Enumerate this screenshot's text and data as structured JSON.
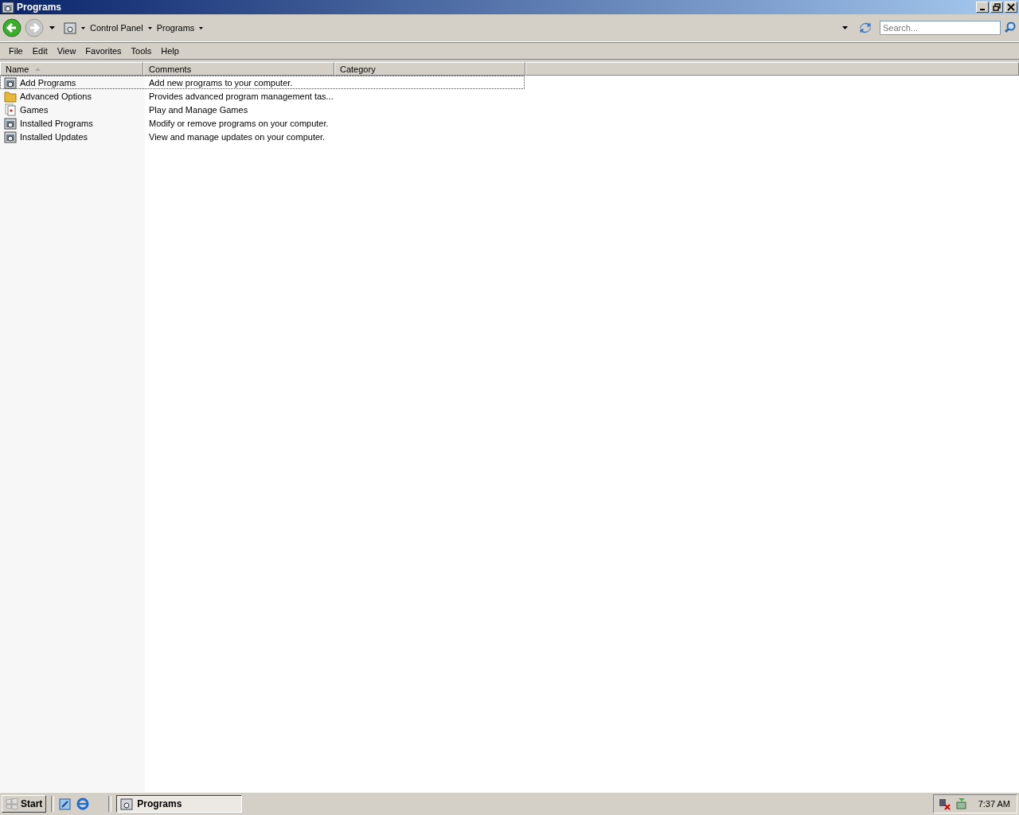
{
  "window": {
    "title": "Programs"
  },
  "address_bar": {
    "crumbs": [
      "Control Panel",
      "Programs"
    ],
    "search": {
      "placeholder": "Search..."
    }
  },
  "menu": [
    "File",
    "Edit",
    "View",
    "Favorites",
    "Tools",
    "Help"
  ],
  "table": {
    "columns": [
      {
        "label": "Name",
        "sorted": true
      },
      {
        "label": "Comments",
        "sorted": false
      },
      {
        "label": "Category",
        "sorted": false
      }
    ],
    "rows": [
      {
        "name": "Add Programs",
        "comment": "Add new programs to your computer.",
        "kind": "program",
        "focused": true
      },
      {
        "name": "Advanced Options",
        "comment": "Provides advanced program management tas...",
        "kind": "folder",
        "focused": false
      },
      {
        "name": "Games",
        "comment": "Play and Manage Games",
        "kind": "games",
        "focused": false
      },
      {
        "name": "Installed Programs",
        "comment": "Modify or remove programs on your computer.",
        "kind": "program",
        "focused": false
      },
      {
        "name": "Installed Updates",
        "comment": "View and manage updates on your computer.",
        "kind": "program",
        "focused": false
      }
    ]
  },
  "taskbar": {
    "start": "Start",
    "tasks": [
      {
        "label": "Programs",
        "selected": true
      }
    ],
    "clock": "7:37 AM"
  }
}
